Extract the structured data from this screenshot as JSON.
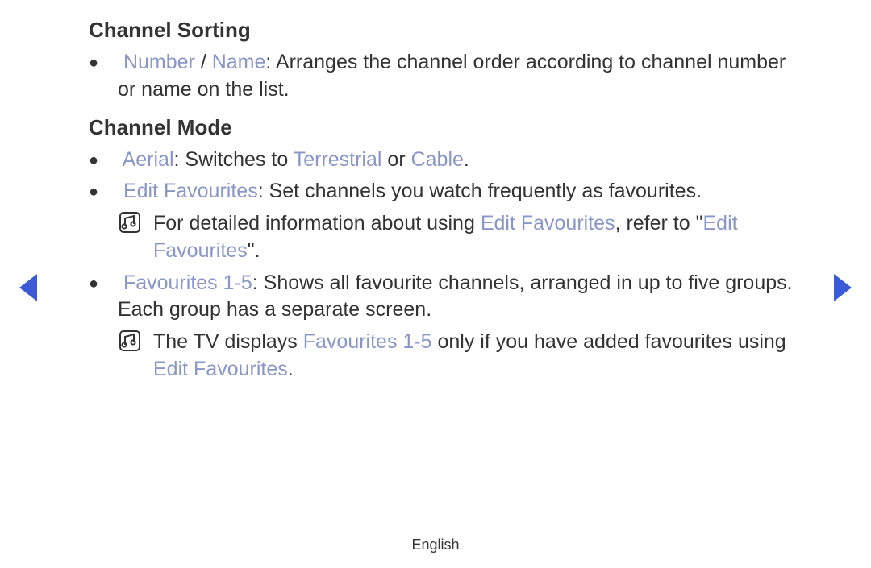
{
  "colors": {
    "highlight": "#8a96c8",
    "nav_arrow": "#3b5bd6"
  },
  "sections": {
    "sorting": {
      "heading": "Channel Sorting",
      "item1": {
        "term_number": "Number",
        "separator": " / ",
        "term_name": "Name",
        "desc": ": Arranges the channel order according to channel number or name on the list."
      }
    },
    "mode": {
      "heading": "Channel Mode",
      "aerial": {
        "term": "Aerial",
        "desc1": ": Switches to ",
        "opt1": "Terrestrial",
        "or": " or ",
        "opt2": "Cable",
        "end": "."
      },
      "editfav": {
        "term": "Edit Favourites",
        "desc": ": Set channels you watch frequently as favourites."
      },
      "note1": {
        "pre": "For detailed information about using ",
        "term": "Edit Favourites",
        "mid": ", refer to \"",
        "term2": "Edit Favourites",
        "end": "\"."
      },
      "fav15": {
        "term": "Favourites 1-5",
        "desc": ": Shows all favourite channels, arranged in up to five groups. Each group has a separate screen."
      },
      "note2": {
        "pre": "The TV displays ",
        "term": "Favourites 1-5",
        "mid": " only if you have added favourites using ",
        "term2": "Edit Favourites",
        "end": "."
      }
    }
  },
  "footer": "English"
}
